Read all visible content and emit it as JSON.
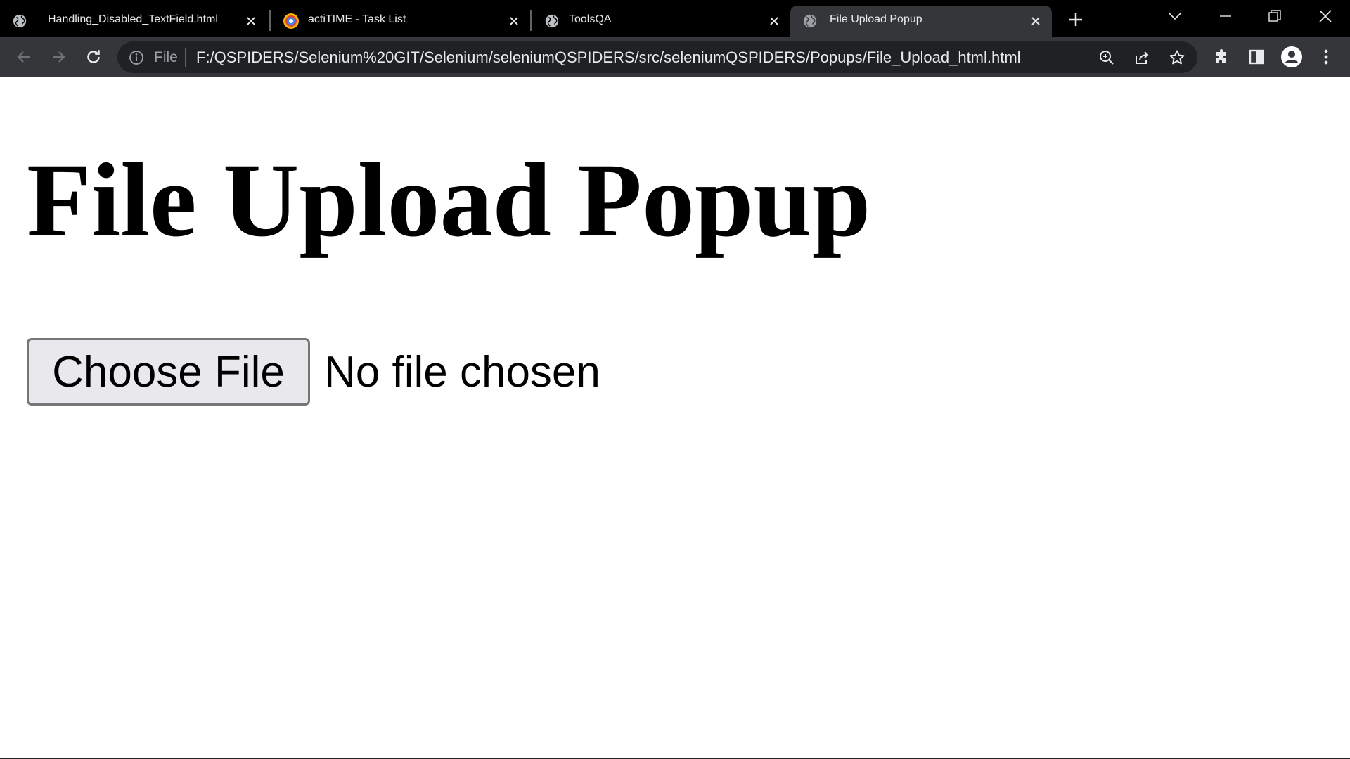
{
  "browser": {
    "tabs": [
      {
        "title": "Handling_Disabled_TextField.html",
        "icon": "globe-icon",
        "active": false
      },
      {
        "title": "actiTIME - Task List",
        "icon": "actitime-logo-icon",
        "active": false
      },
      {
        "title": "ToolsQA",
        "icon": "globe-icon",
        "active": false
      },
      {
        "title": "File Upload Popup",
        "icon": "globe-icon",
        "active": true
      }
    ],
    "omnibox": {
      "chip": "File",
      "url": "F:/QSPIDERS/Selenium%20GIT/Selenium/seleniumQSPIDERS/src/seleniumQSPIDERS/Popups/File_Upload_html.html"
    },
    "colors": {
      "tabstrip": "#000000",
      "toolbar": "#35363a",
      "omnibox": "#202124",
      "text": "#e8eaed"
    }
  },
  "page": {
    "heading": "File Upload Popup",
    "file_input": {
      "button_label": "Choose File",
      "status": "No file chosen"
    }
  }
}
